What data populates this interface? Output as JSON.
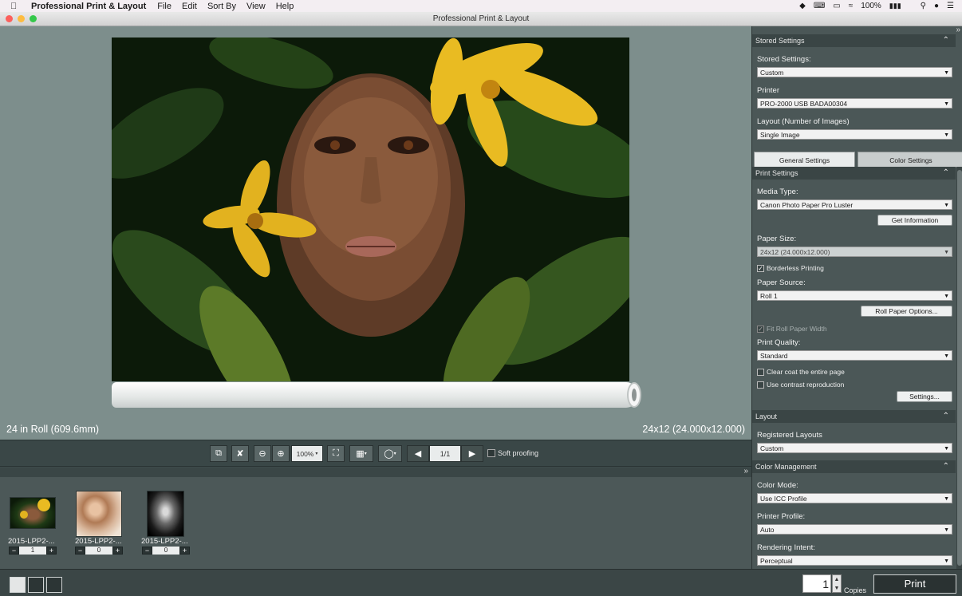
{
  "menubar": {
    "app": "Professional Print & Layout",
    "items": [
      "File",
      "Edit",
      "Sort By",
      "View",
      "Help"
    ],
    "battery": "100%"
  },
  "window": {
    "title": "Professional Print & Layout"
  },
  "preview": {
    "roll_label": "24 in Roll (609.6mm)",
    "size_label": "24x12 (24.000x12.000)"
  },
  "toolbar": {
    "zoom": "100%",
    "page": "1/1",
    "soft_proofing": "Soft proofing"
  },
  "thumbnails": [
    {
      "name": "2015-LPP2-...",
      "count": "1"
    },
    {
      "name": "2015-LPP2-...",
      "count": "0"
    },
    {
      "name": "2015-LPP2-...",
      "count": "0"
    }
  ],
  "bottom": {
    "copies_value": "1",
    "copies_label": "Copies",
    "print_label": "Print"
  },
  "panel": {
    "stored_header": "Stored Settings",
    "stored_label": "Stored Settings:",
    "stored_value": "Custom",
    "printer_label": "Printer",
    "printer_value": "PRO-2000 USB BADA00304",
    "layout_label": "Layout (Number of Images)",
    "layout_value": "Single Image",
    "tab_general": "General Settings",
    "tab_color": "Color Settings",
    "print_settings_header": "Print Settings",
    "media_label": "Media Type:",
    "media_value": "Canon Photo Paper Pro Luster",
    "get_info": "Get Information",
    "paper_size_label": "Paper Size:",
    "paper_size_value": "24x12 (24.000x12.000)",
    "borderless": "Borderless Printing",
    "paper_source_label": "Paper Source:",
    "paper_source_value": "Roll 1",
    "roll_options": "Roll Paper Options...",
    "fit_roll": "Fit Roll Paper Width",
    "quality_label": "Print Quality:",
    "quality_value": "Standard",
    "clear_coat": "Clear coat the entire page",
    "contrast": "Use contrast reproduction",
    "settings_btn": "Settings...",
    "layout_header": "Layout",
    "registered_label": "Registered Layouts",
    "registered_value": "Custom",
    "cm_header": "Color Management",
    "color_mode_label": "Color Mode:",
    "color_mode_value": "Use ICC Profile",
    "printer_profile_label": "Printer Profile:",
    "printer_profile_value": "Auto",
    "rendering_label": "Rendering Intent:",
    "rendering_value": "Perceptual"
  }
}
